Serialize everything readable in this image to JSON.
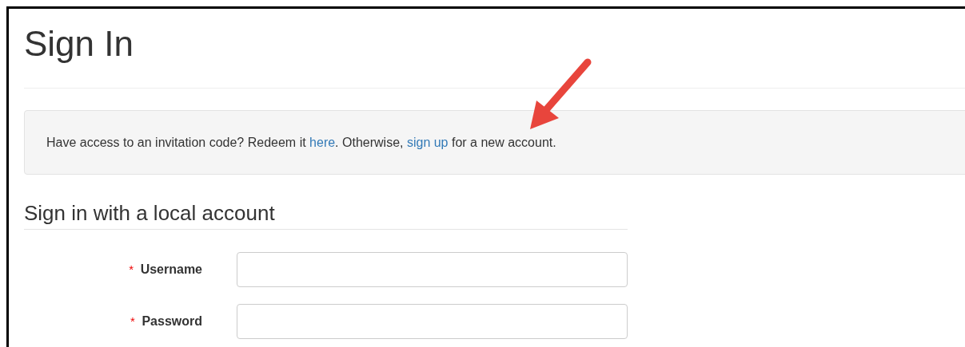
{
  "title": "Sign In",
  "notice": [
    {
      "kind": "text",
      "text": "Have access to an invitation code? Redeem it "
    },
    {
      "kind": "link",
      "text": "here"
    },
    {
      "kind": "text",
      "text": ". Otherwise, "
    },
    {
      "kind": "link",
      "text": "sign up"
    },
    {
      "kind": "text",
      "text": " for a new account."
    }
  ],
  "section_title": "Sign in with a local account",
  "fields": [
    {
      "label": "Username",
      "required_mark": "*"
    },
    {
      "label": "Password",
      "required_mark": "*"
    }
  ]
}
